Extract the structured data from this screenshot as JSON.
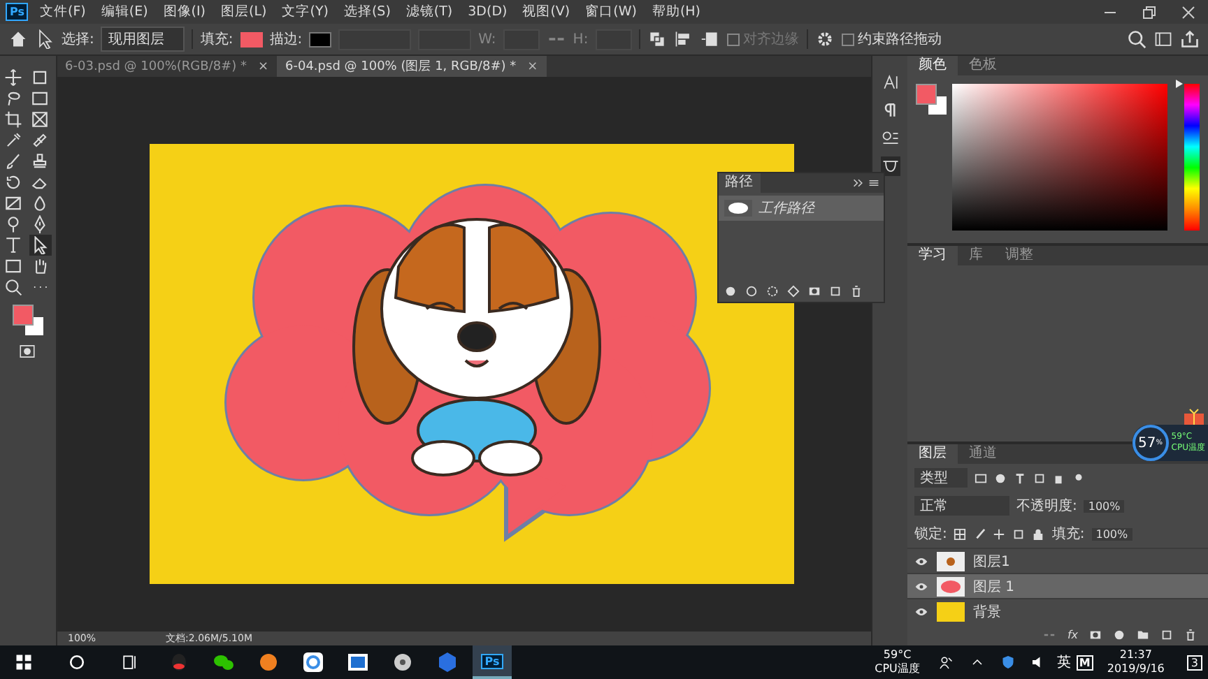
{
  "app_logo": "Ps",
  "menu": [
    "文件(F)",
    "编辑(E)",
    "图像(I)",
    "图层(L)",
    "文字(Y)",
    "选择(S)",
    "滤镜(T)",
    "3D(D)",
    "视图(V)",
    "窗口(W)",
    "帮助(H)"
  ],
  "options_bar": {
    "select_label": "选择:",
    "select_value": "现用图层",
    "fill_label": "填充:",
    "stroke_label": "描边:",
    "w_label": "W:",
    "h_label": "H:",
    "align_edges": {
      "label": "对齐边缘",
      "disabled": true,
      "checked": false
    },
    "constrain": {
      "label": "约束路径拖动",
      "checked": false,
      "disabled": false
    }
  },
  "tools": [
    {
      "kind": "move",
      "selected": false
    },
    {
      "kind": "artboard",
      "selected": false
    },
    {
      "kind": "lasso",
      "selected": false
    },
    {
      "kind": "marquee",
      "selected": false
    },
    {
      "kind": "crop",
      "selected": false
    },
    {
      "kind": "frame",
      "selected": false
    },
    {
      "kind": "eyedropper",
      "selected": false
    },
    {
      "kind": "heal",
      "selected": false
    },
    {
      "kind": "brush",
      "selected": false
    },
    {
      "kind": "stamp",
      "selected": false
    },
    {
      "kind": "history",
      "selected": false
    },
    {
      "kind": "eraser",
      "selected": false
    },
    {
      "kind": "gradient",
      "selected": false
    },
    {
      "kind": "blur",
      "selected": false
    },
    {
      "kind": "dodge",
      "selected": false
    },
    {
      "kind": "pen",
      "selected": false
    },
    {
      "kind": "type",
      "selected": false
    },
    {
      "kind": "path",
      "selected": true
    },
    {
      "kind": "shape",
      "selected": false
    },
    {
      "kind": "hand",
      "selected": false
    },
    {
      "kind": "zoom",
      "selected": false
    },
    {
      "kind": "more",
      "selected": false
    }
  ],
  "tabs": [
    {
      "label": "6-03.psd @ 100%(RGB/8#) *",
      "close": "×",
      "selected": false
    },
    {
      "label": "6-04.psd @ 100% (图层 1, RGB/8#) *",
      "close": "×",
      "selected": true
    }
  ],
  "paths_panel": {
    "title": "路径",
    "items": [
      {
        "label": "工作路径",
        "selected": true
      }
    ]
  },
  "status_bar": {
    "zoom": "100%",
    "doc": "文档:2.06M/5.10M"
  },
  "color_panel": {
    "tabs": [
      {
        "label": "颜色",
        "selected": true
      },
      {
        "label": "色板",
        "selected": false
      }
    ],
    "hue": {
      "level": 1
    }
  },
  "learn_panel": {
    "tabs": [
      {
        "label": "学习",
        "selected": true
      },
      {
        "label": "库",
        "selected": false
      },
      {
        "label": "调整",
        "selected": false
      }
    ]
  },
  "cpu_widget": {
    "value": "57",
    "unit": "%",
    "temp": "59°C",
    "label": "CPU温度"
  },
  "layers_panel": {
    "tabs": [
      {
        "label": "图层",
        "selected": true
      },
      {
        "label": "通道",
        "selected": false
      }
    ],
    "filter": "类型",
    "blend": "正常",
    "opacity_label": "不透明度:",
    "opacity": "100%",
    "lock_label": "锁定:",
    "fill_label": "填充:",
    "fill": "100%",
    "fx": "fx",
    "layers": [
      {
        "name": "图层1",
        "kind": "image",
        "visible": true,
        "selected": false
      },
      {
        "name": "图层 1",
        "kind": "shape",
        "visible": true,
        "selected": true
      },
      {
        "name": "背景",
        "kind": "background",
        "visible": true,
        "selected": false
      }
    ]
  },
  "taskbar": {
    "apps": [
      {
        "kind": "qq",
        "selected": false
      },
      {
        "kind": "wechat",
        "selected": false
      },
      {
        "kind": "orange",
        "selected": false
      },
      {
        "kind": "cloud",
        "selected": false
      },
      {
        "kind": "square",
        "selected": false
      },
      {
        "kind": "disk",
        "selected": false
      },
      {
        "kind": "wps",
        "selected": false
      },
      {
        "kind": "ps",
        "selected": true
      }
    ],
    "ps_label": "Ps",
    "temp": "59°C",
    "temp_label": "CPU温度",
    "ime": "英",
    "ime_icon": "M",
    "time": "21:37",
    "date": "2019/9/16",
    "notifications": "3"
  }
}
